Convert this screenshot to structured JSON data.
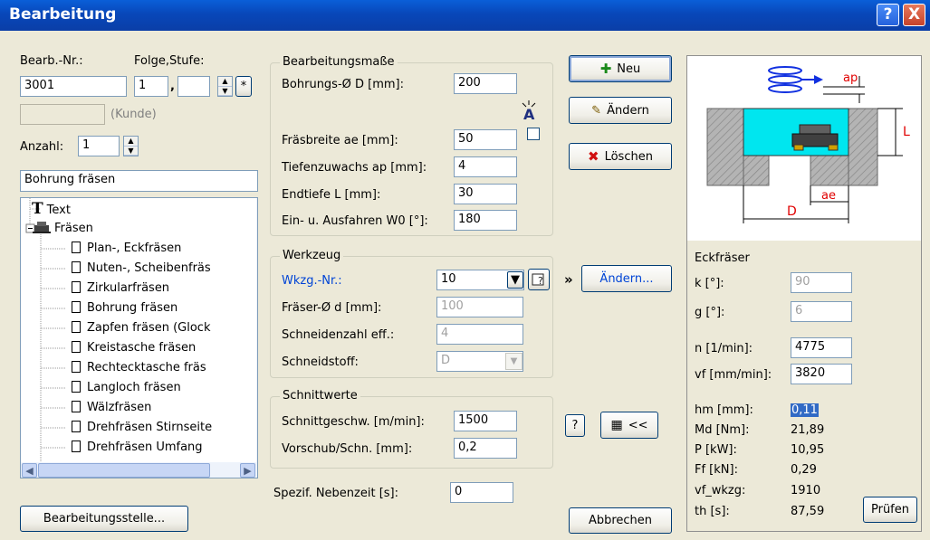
{
  "window": {
    "title": "Bearbeitung",
    "help_glyph": "?",
    "close_glyph": "X"
  },
  "left": {
    "bearb_nr_label": "Bearb.-Nr.:",
    "folge_stufe_label": "Folge,Stufe:",
    "bearb_nr_value": "3001",
    "folge_value": "1",
    "stufe_value": "",
    "star_button": "*",
    "kunde_label": "(Kunde)",
    "anzahl_label": "Anzahl:",
    "anzahl_value": "1",
    "selected_name": "Bohrung fräsen",
    "tree": [
      {
        "label": "Text",
        "icon": "text-icon",
        "level": 0
      },
      {
        "label": "Fräsen",
        "icon": "milling-icon",
        "level": 0
      },
      {
        "label": "Plan-, Eckfräsen",
        "icon": "document-icon",
        "level": 1
      },
      {
        "label": "Nuten-, Scheibenfräs",
        "icon": "document-icon",
        "level": 1
      },
      {
        "label": "Zirkularfräsen",
        "icon": "document-icon",
        "level": 1
      },
      {
        "label": "Bohrung fräsen",
        "icon": "document-icon",
        "level": 1
      },
      {
        "label": "Zapfen fräsen (Glock",
        "icon": "document-icon",
        "level": 1
      },
      {
        "label": "Kreistasche fräsen",
        "icon": "document-icon",
        "level": 1
      },
      {
        "label": "Rechtecktasche fräs",
        "icon": "document-icon",
        "level": 1
      },
      {
        "label": "Langloch fräsen",
        "icon": "document-icon",
        "level": 1
      },
      {
        "label": "Wälzfräsen",
        "icon": "document-icon",
        "level": 1
      },
      {
        "label": "Drehfräsen Stirnseite",
        "icon": "document-icon",
        "level": 1
      },
      {
        "label": "Drehfräsen Umfang",
        "icon": "document-icon",
        "level": 1
      }
    ],
    "bearbeitungsstelle_button": "Bearbeitungsstelle..."
  },
  "masse": {
    "title": "Bearbeitungsmaße",
    "bohrung_label": "Bohrungs-Ø D [mm]:",
    "bohrung_value": "200",
    "fraesbreite_label": "Fräsbreite ae [mm]:",
    "fraesbreite_value": "50",
    "tiefenzuwachs_label": "Tiefenzuwachs ap [mm]:",
    "tiefenzuwachs_value": "4",
    "endtiefe_label": "Endtiefe L [mm]:",
    "endtiefe_value": "30",
    "einaus_label": "Ein- u. Ausfahren W0 [°]:",
    "einaus_value": "180"
  },
  "werkzeug": {
    "title": "Werkzeug",
    "wkzg_label": "Wkzg.-Nr.:",
    "wkzg_value": "10",
    "fraeser_label": "Fräser-Ø d [mm]:",
    "fraeser_value": "100",
    "schneidenzahl_label": "Schneidenzahl eff.:",
    "schneidenzahl_value": "4",
    "schneidstoff_label": "Schneidstoff:",
    "schneidstoff_value": "D",
    "aendern_link": "Ändern..."
  },
  "schnitt": {
    "title": "Schnittwerte",
    "geschw_label": "Schnittgeschw. [m/min]:",
    "geschw_value": "1500",
    "vorschub_label": "Vorschub/Schn. [mm]:",
    "vorschub_value": "0,2"
  },
  "nebenzeit": {
    "label": "Spezif. Nebenzeit [s]:",
    "value": "0"
  },
  "buttons": {
    "neu": "Neu",
    "aendern": "Ändern",
    "loeschen": "Löschen",
    "question": "?",
    "calc": "<<",
    "abbrechen": "Abbrechen",
    "pruefen": "Prüfen",
    "chevron": "»"
  },
  "right": {
    "tool_type": "Eckfräser",
    "k_label": "k [°]:",
    "k_value": "90",
    "g_label": "g [°]:",
    "g_value": "6",
    "n_label": "n [1/min]:",
    "n_value": "4775",
    "vf_label": "vf [mm/min]:",
    "vf_value": "3820",
    "results": [
      {
        "label": "hm [mm]:",
        "value": "0,11"
      },
      {
        "label": "Md [Nm]:",
        "value": "21,89"
      },
      {
        "label": "P [kW]:",
        "value": "10,95"
      },
      {
        "label": "Ff [kN]:",
        "value": "0,29"
      },
      {
        "label": "vf_wkzg:",
        "value": "1910"
      },
      {
        "label": "th [s]:",
        "value": "87,59"
      }
    ],
    "drawing_labels": {
      "ap": "ap",
      "L": "L",
      "ae": "ae",
      "D": "D"
    }
  },
  "colors": {
    "titlebar": "#0847b9",
    "cavity": "#00e6ef",
    "link": "#0044d6",
    "selection": "#316ac5"
  }
}
